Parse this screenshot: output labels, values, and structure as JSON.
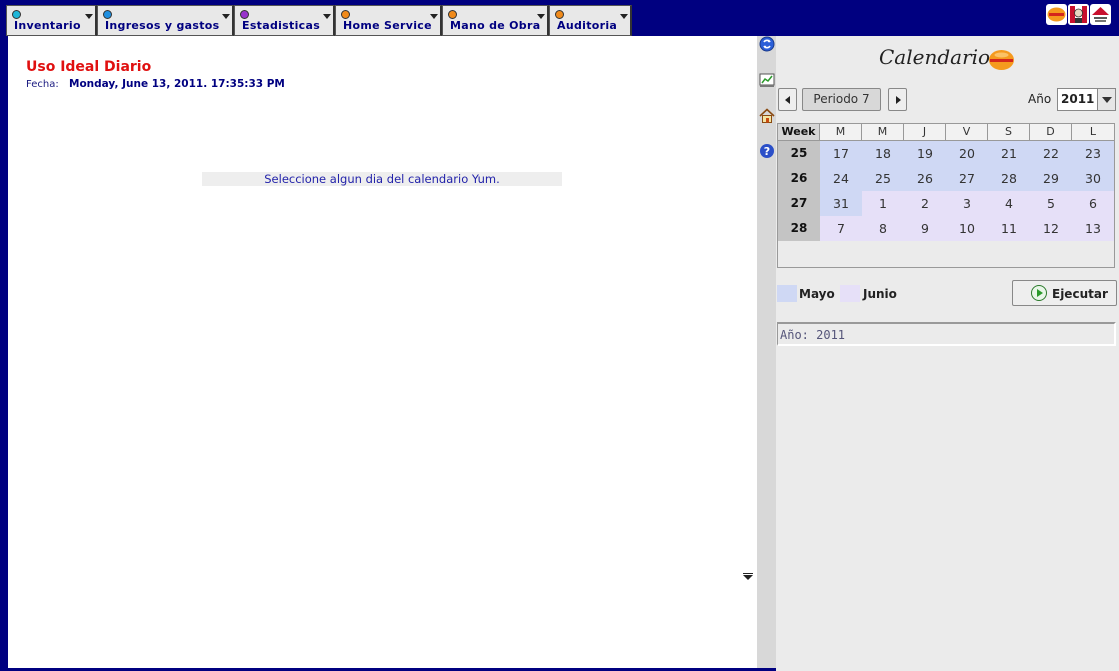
{
  "menu": {
    "items": [
      {
        "label": "Inventario",
        "dot_color": "#1fb6d8"
      },
      {
        "label": "Ingresos y gastos",
        "dot_color": "#1f8fe0"
      },
      {
        "label": "Estadisticas",
        "dot_color": "#9933cc"
      },
      {
        "label": "Home Service",
        "dot_color": "#f08a1a"
      },
      {
        "label": "Mano de Obra",
        "dot_color": "#f08a1a"
      },
      {
        "label": "Auditoria",
        "dot_color": "#f08a1a"
      }
    ]
  },
  "brands": [
    "el-portón",
    "kfc",
    "pizza-hut"
  ],
  "report": {
    "title": "Uso Ideal Diario",
    "fecha_label": "Fecha:",
    "fecha_value": "Monday, June 13, 2011. 17:35:33 PM",
    "message": "Seleccione algun dia del calendario Yum."
  },
  "tool_icons": [
    "refresh-icon",
    "chart-icon",
    "home-icon",
    "help-icon"
  ],
  "calendar": {
    "title": "Calendario",
    "period_label": "Periodo 7",
    "year_label": "Año",
    "year_value": "2011",
    "headers": [
      "Week",
      "M",
      "M",
      "J",
      "V",
      "S",
      "D",
      "L"
    ],
    "weeks": [
      {
        "week": "25",
        "days": [
          {
            "d": "17",
            "m": "mayo"
          },
          {
            "d": "18",
            "m": "mayo"
          },
          {
            "d": "19",
            "m": "mayo"
          },
          {
            "d": "20",
            "m": "mayo"
          },
          {
            "d": "21",
            "m": "mayo"
          },
          {
            "d": "22",
            "m": "mayo"
          },
          {
            "d": "23",
            "m": "mayo"
          }
        ]
      },
      {
        "week": "26",
        "days": [
          {
            "d": "24",
            "m": "mayo"
          },
          {
            "d": "25",
            "m": "mayo"
          },
          {
            "d": "26",
            "m": "mayo"
          },
          {
            "d": "27",
            "m": "mayo"
          },
          {
            "d": "28",
            "m": "mayo"
          },
          {
            "d": "29",
            "m": "mayo"
          },
          {
            "d": "30",
            "m": "mayo"
          }
        ]
      },
      {
        "week": "27",
        "days": [
          {
            "d": "31",
            "m": "mayo"
          },
          {
            "d": "1",
            "m": "junio"
          },
          {
            "d": "2",
            "m": "junio"
          },
          {
            "d": "3",
            "m": "junio"
          },
          {
            "d": "4",
            "m": "junio"
          },
          {
            "d": "5",
            "m": "junio"
          },
          {
            "d": "6",
            "m": "junio"
          }
        ]
      },
      {
        "week": "28",
        "days": [
          {
            "d": "7",
            "m": "junio"
          },
          {
            "d": "8",
            "m": "junio"
          },
          {
            "d": "9",
            "m": "junio"
          },
          {
            "d": "10",
            "m": "junio"
          },
          {
            "d": "11",
            "m": "junio"
          },
          {
            "d": "12",
            "m": "junio"
          },
          {
            "d": "13",
            "m": "junio"
          }
        ]
      }
    ],
    "legend": [
      {
        "label": "Mayo",
        "color": "#cfd8f4"
      },
      {
        "label": "Junio",
        "color": "#e6e0f8"
      }
    ],
    "run_label": "Ejecutar",
    "status": "Año: 2011"
  }
}
